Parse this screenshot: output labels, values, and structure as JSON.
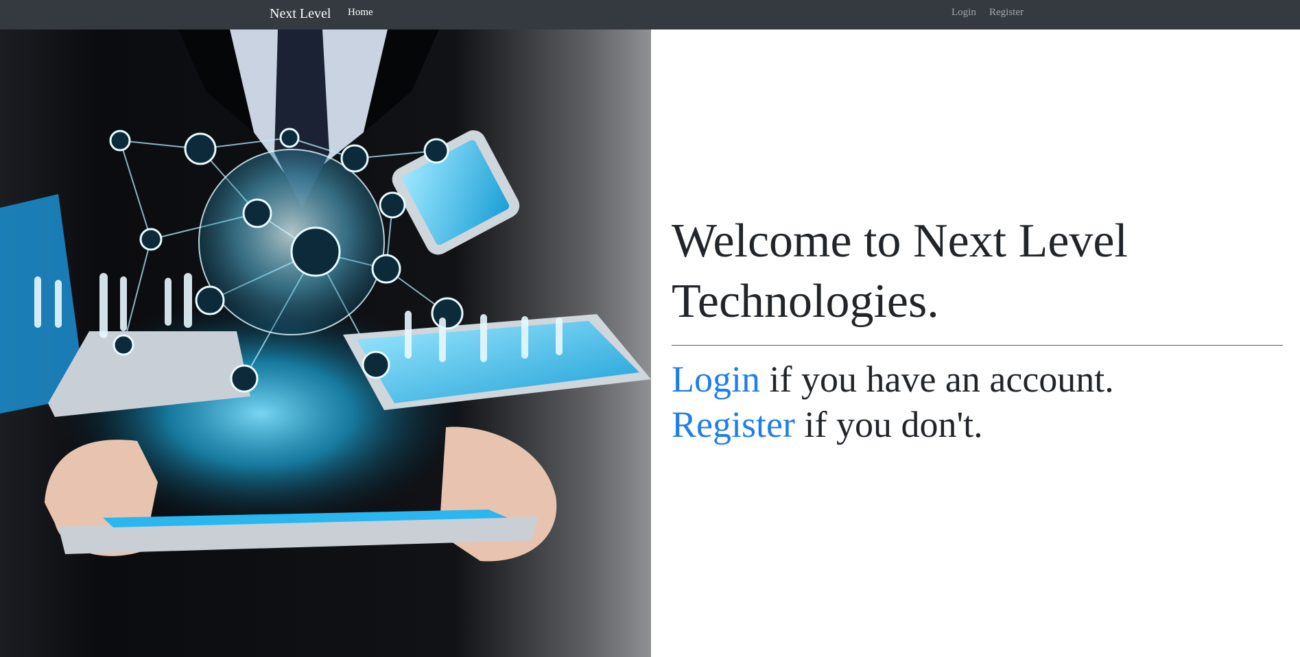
{
  "navbar": {
    "brand": "Next Level",
    "home": "Home",
    "login": "Login",
    "register": "Register",
    "background": "#343a40"
  },
  "hero_image": {
    "description_icon": "business-technology-photo"
  },
  "main": {
    "title": "Welcome to Next Level Technologies.",
    "login_link": "Login",
    "login_text": " if you have an account.",
    "register_link": "Register",
    "register_text": " if you don't.",
    "link_color": "#1e7fe8"
  }
}
